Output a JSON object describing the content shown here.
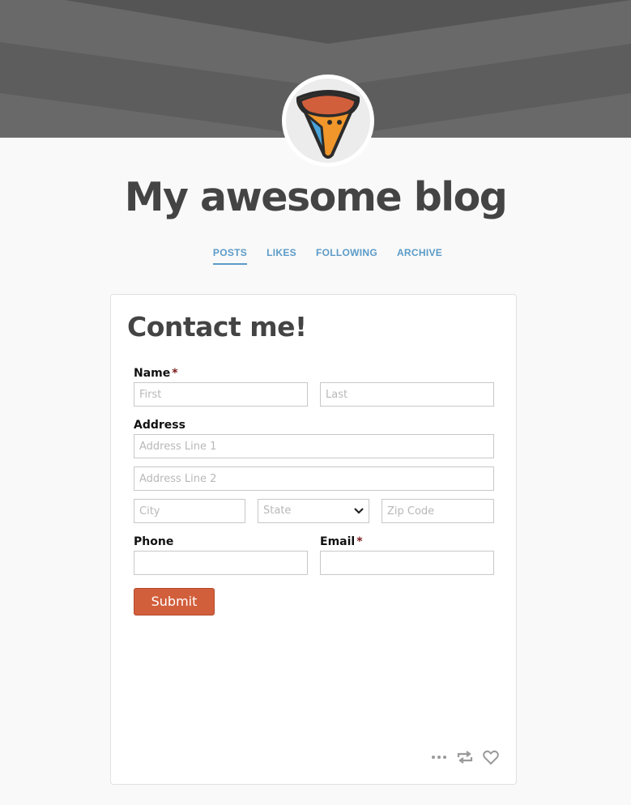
{
  "blog": {
    "title": "My awesome blog"
  },
  "nav": {
    "items": [
      {
        "label": "POSTS",
        "active": true
      },
      {
        "label": "LIKES",
        "active": false
      },
      {
        "label": "FOLLOWING",
        "active": false
      },
      {
        "label": "ARCHIVE",
        "active": false
      }
    ]
  },
  "post": {
    "title": "Contact me!",
    "form": {
      "name_label": "Name",
      "required_mark": "*",
      "first_placeholder": "First",
      "last_placeholder": "Last",
      "address_label": "Address",
      "address1_placeholder": "Address Line 1",
      "address2_placeholder": "Address Line 2",
      "city_placeholder": "City",
      "state_value": "State",
      "zip_placeholder": "Zip Code",
      "phone_label": "Phone",
      "email_label": "Email",
      "submit_label": "Submit"
    },
    "actions": [
      "more-icon",
      "reblog-icon",
      "heart-icon"
    ]
  },
  "colors": {
    "header": "#5c5d5c",
    "accent_link": "#5b9bc8",
    "submit": "#d25f3c",
    "required": "#7a1b1b"
  }
}
